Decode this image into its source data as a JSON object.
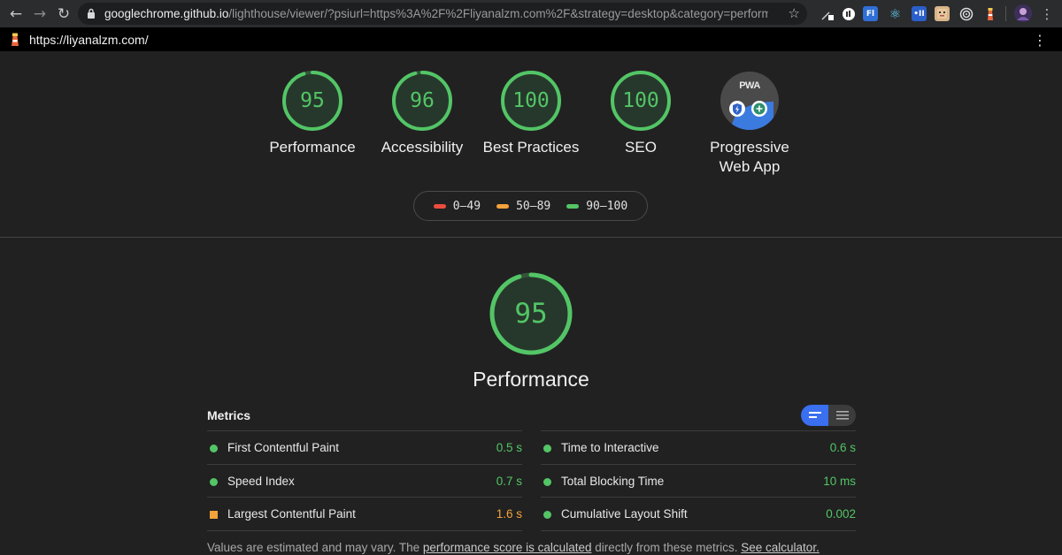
{
  "browser": {
    "url_host": "googlechrome.github.io",
    "url_rest": "/lighthouse/viewer/?psiurl=https%3A%2F%2Fliyanalzm.com%2F&strategy=desktop&category=performance&categ...",
    "extensions": [
      "pen-icon",
      "chart-icon",
      "fl-icon",
      "react-icon",
      "m-icon",
      "face-icon",
      "target-icon",
      "lighthouse-icon",
      "avatar"
    ]
  },
  "appbar": {
    "url": "https://liyanalzm.com/"
  },
  "gauges": [
    {
      "score": "95",
      "label": "Performance"
    },
    {
      "score": "96",
      "label": "Accessibility"
    },
    {
      "score": "100",
      "label": "Best Practices"
    },
    {
      "score": "100",
      "label": "SEO"
    }
  ],
  "pwa": {
    "badge": "PWA",
    "label_line1": "Progressive",
    "label_line2": "Web App"
  },
  "legend": {
    "fail": "0–49",
    "average": "50–89",
    "pass": "90–100"
  },
  "performance": {
    "score": "95",
    "title": "Performance"
  },
  "metrics": {
    "title": "Metrics",
    "left": [
      {
        "name": "First Contentful Paint",
        "value": "0.5 s",
        "rating": "pass"
      },
      {
        "name": "Speed Index",
        "value": "0.7 s",
        "rating": "pass"
      },
      {
        "name": "Largest Contentful Paint",
        "value": "1.6 s",
        "rating": "average"
      }
    ],
    "right": [
      {
        "name": "Time to Interactive",
        "value": "0.6 s",
        "rating": "pass"
      },
      {
        "name": "Total Blocking Time",
        "value": "10 ms",
        "rating": "pass"
      },
      {
        "name": "Cumulative Layout Shift",
        "value": "0.002",
        "rating": "pass"
      }
    ]
  },
  "footnote": {
    "text1": "Values are estimated and may vary. The ",
    "link1": "performance score is calculated",
    "text2": " directly from these metrics. ",
    "link2": "See calculator."
  },
  "colors": {
    "pass": "#53c566",
    "average": "#f4a23c",
    "fail": "#eb4d3d",
    "toggle_on": "#3a6ff0"
  }
}
